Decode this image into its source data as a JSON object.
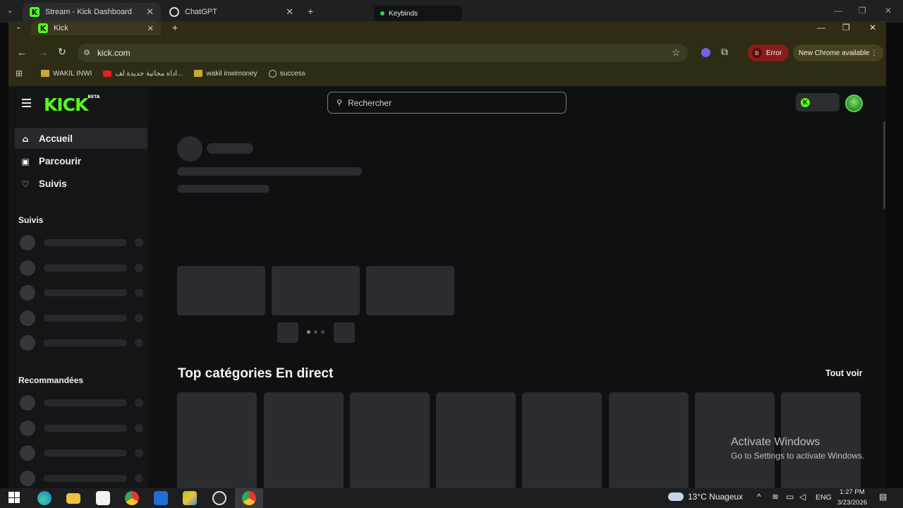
{
  "outer_tabs": [
    {
      "label": "Stream - Kick Dashboard"
    },
    {
      "label": "ChatGPT"
    }
  ],
  "keybinds_label": "Keybinds",
  "inner_tab": {
    "label": "Kick"
  },
  "address": {
    "url": "kick.com"
  },
  "bookmarks": [
    {
      "label": "WAKIL INWI",
      "icon": "folder-icon"
    },
    {
      "label": "اداة مجانية جديدة لف...",
      "icon": "youtube-icon"
    },
    {
      "label": "wakil inwimoney",
      "icon": "folder-icon"
    },
    {
      "label": "success",
      "icon": "globe-icon"
    }
  ],
  "error_pill": {
    "avatar": "b",
    "label": "Error"
  },
  "new_chrome": {
    "label": "New Chrome available"
  },
  "kick": {
    "logo": "KICK",
    "logo_badge": "BETA",
    "search_placeholder": "Rechercher",
    "nav": [
      {
        "label": "Accueil",
        "icon": "home-icon",
        "selected": true
      },
      {
        "label": "Parcourir",
        "icon": "browse-icon",
        "selected": false
      },
      {
        "label": "Suivis",
        "icon": "heart-icon",
        "selected": false
      }
    ],
    "section_followed": "Suivis",
    "section_recommended": "Recommandées",
    "top_categories_title": "Top catégories En direct",
    "see_all": "Tout voir"
  },
  "watermark": {
    "title": "Activate Windows",
    "subtitle": "Go to Settings to activate Windows."
  },
  "taskbar": {
    "weather": "13°C Nuageux",
    "lang": "ENG",
    "time": "1:27 PM",
    "date": "3/23/2026"
  },
  "colors": {
    "kick_green": "#53fc18",
    "page_bg": "#0f1011",
    "sidebar_bg": "#141517",
    "skeleton": "#2a2c2f"
  }
}
